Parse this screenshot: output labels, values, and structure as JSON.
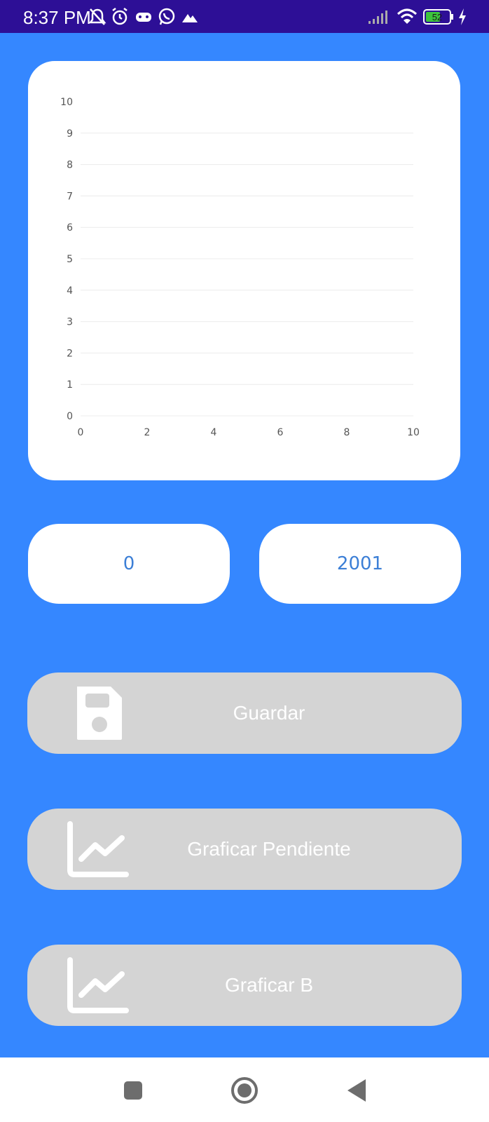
{
  "status_bar": {
    "time": "8:37 PM",
    "battery": "52",
    "icons": [
      "alarm-off-icon",
      "alarm-icon",
      "game-controller-icon",
      "whatsapp-icon",
      "mountain-icon",
      "signal-icon",
      "wifi-icon",
      "battery-icon",
      "charging-icon"
    ]
  },
  "chart_data": {
    "type": "line",
    "x_ticks": [
      "0",
      "2",
      "4",
      "6",
      "8",
      "10"
    ],
    "y_ticks": [
      "0",
      "1",
      "2",
      "3",
      "4",
      "5",
      "6",
      "7",
      "8",
      "9",
      "10"
    ],
    "xlim": [
      0,
      10
    ],
    "ylim": [
      0,
      10
    ],
    "series": [],
    "grid": "horizontal"
  },
  "inputs": {
    "left_value": "0",
    "right_value": "2001"
  },
  "buttons": {
    "save_label": "Guardar",
    "graph_slope_label": "Graficar Pendiente",
    "graph_b_label": "Graficar B"
  },
  "colors": {
    "background": "#3587ff",
    "status_bar": "#2d0f96",
    "button": "#d4d4d4",
    "value_text": "#3c7fd6"
  },
  "nav": [
    "recents-icon",
    "home-icon",
    "back-icon"
  ]
}
